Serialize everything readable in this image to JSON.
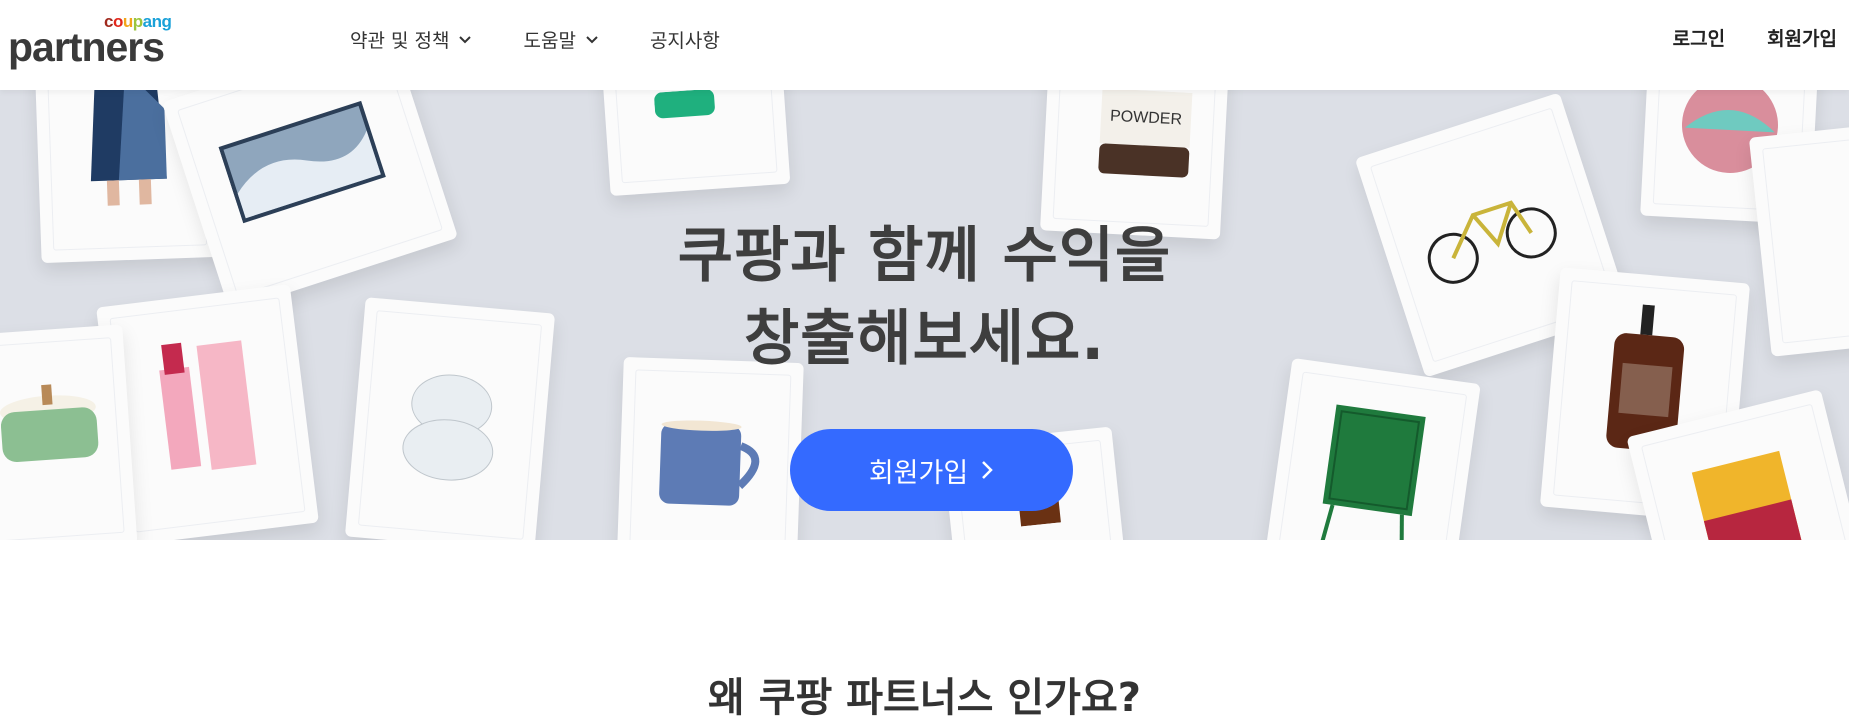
{
  "logo": {
    "coupang_letters": [
      {
        "ch": "c",
        "color": "#a02a1e"
      },
      {
        "ch": "o",
        "color": "#e2271b"
      },
      {
        "ch": "u",
        "color": "#f2a51b"
      },
      {
        "ch": "p",
        "color": "#9bc53d"
      },
      {
        "ch": "a",
        "color": "#1aa1d8"
      },
      {
        "ch": "n",
        "color": "#1aa1d8"
      },
      {
        "ch": "g",
        "color": "#1aa1d8"
      }
    ],
    "partners": "partners"
  },
  "nav": {
    "items": [
      {
        "label": "약관 및 정책",
        "has_dropdown": true
      },
      {
        "label": "도움말",
        "has_dropdown": true
      },
      {
        "label": "공지사항",
        "has_dropdown": false
      }
    ]
  },
  "auth": {
    "login": "로그인",
    "signup": "회원가입"
  },
  "hero": {
    "title_line1": "쿠팡과 함께 수익을",
    "title_line2": "창출해보세요.",
    "cta_label": "회원가입",
    "bg_color": "#dcdfe6",
    "cta_color": "#346aff"
  },
  "section": {
    "title": "왜 쿠팡 파트너스 인가요?"
  }
}
